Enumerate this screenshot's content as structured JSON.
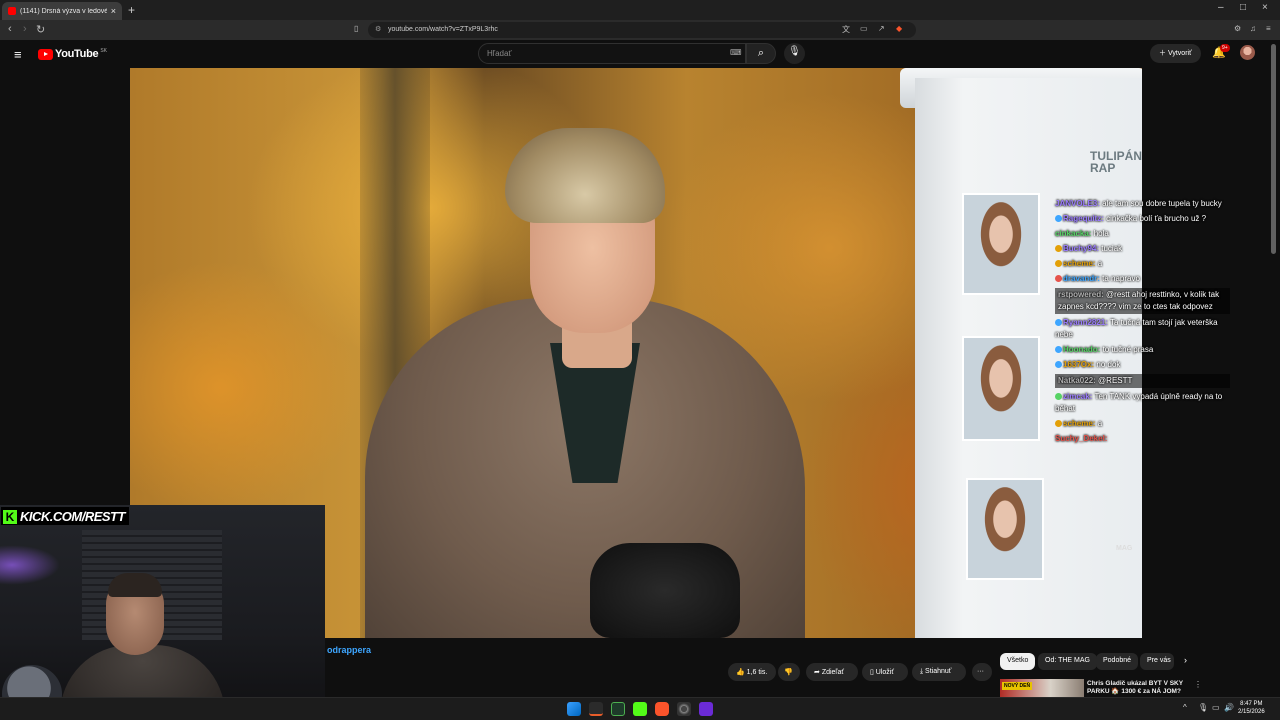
{
  "browser": {
    "tab_title": "(1141) Drsná výzva v ledové ...",
    "tab_close": "×",
    "new_tab": "+",
    "url": "youtube.com/watch?v=ZTxP9L3rhc",
    "window_controls": [
      "–",
      "□",
      "×"
    ]
  },
  "youtube": {
    "logo_text": "YouTube",
    "country_code": "SK",
    "search_placeholder": "Hľadať",
    "create_label": "Vytvoriť",
    "notification_count": "9+"
  },
  "video": {
    "board_logo": "TULIPÁN\nRAP",
    "watermark": "MAG",
    "overlay_url": "KICK.COM/RESTT"
  },
  "chat": {
    "messages": [
      {
        "user": "JANVOLE3:",
        "text": "ale tam sou dobre tupela ty bucky",
        "color": "#9b7cff",
        "badge": ""
      },
      {
        "user": "Ragequitz:",
        "text": "cinkačka bolí ťa brucho už ?",
        "color": "#9b7cff",
        "badge": "#3ea6ff"
      },
      {
        "user": "cinkacka:",
        "text": "hola",
        "color": "#56d364",
        "badge": ""
      },
      {
        "user": "Buchy94:",
        "text": "tuciak",
        "color": "#9b7cff",
        "badge": "#e3a008"
      },
      {
        "user": "scheme:",
        "text": "a",
        "color": "#e3a008",
        "badge": "#e3a008"
      },
      {
        "user": "dravandr:",
        "text": "ta napravo",
        "color": "#3ea6ff",
        "badge": "#e5534b"
      },
      {
        "user": "rstpowered:",
        "text": "@restt ahoj resttinko, v kolik tak zapnes kcd???? vim ze to ctes tak odpovez",
        "color": "#b0b0b0",
        "badge": "",
        "highlight": true
      },
      {
        "user": "Ryann2821:",
        "text": "Ta tučná tam stojí jak veterška nebe",
        "color": "#9b7cff",
        "badge": "#3ea6ff"
      },
      {
        "user": "Hoonado:",
        "text": "to tučné prasa",
        "color": "#56d364",
        "badge": "#3ea6ff"
      },
      {
        "user": "1637Ox:",
        "text": "no dok",
        "color": "#e3a008",
        "badge": "#3ea6ff"
      },
      {
        "user": "Natka022:",
        "text": "@RESTT",
        "color": "#b0b0b0",
        "badge": "",
        "highlight": true
      },
      {
        "user": "zimcak:",
        "text": "Ten TANK vypadá úplně ready na to běhat",
        "color": "#9b7cff",
        "badge": "#56d364"
      },
      {
        "user": "scheme:",
        "text": "a",
        "color": "#e3a008",
        "badge": "#e3a008"
      },
      {
        "user": "Suchy_Dekel:",
        "text": "",
        "color": "#e5534b",
        "badge": ""
      }
    ]
  },
  "below_player": {
    "channel_name": "odrappera",
    "like_count": "1,6 tis.",
    "share_label": "Zdieľať",
    "save_label": "Uložiť",
    "download_label": "Stiahnuť",
    "more_label": "···"
  },
  "chips": [
    "Všetko",
    "Od: THE MAG",
    "Podobné",
    "Pre vás"
  ],
  "recommendation": {
    "badge": "NOVÝ DEŇ",
    "title": "Chris Gladič ukázal BYT V SKY PARKU 🏠 1300 € za NÁ JOM?"
  },
  "taskbar": {
    "time": "8:47 PM",
    "date": "2/15/2026"
  },
  "colors": {
    "youtube_red": "#ff0000",
    "kick_green": "#53fc18",
    "link_blue": "#3ea6ff"
  }
}
